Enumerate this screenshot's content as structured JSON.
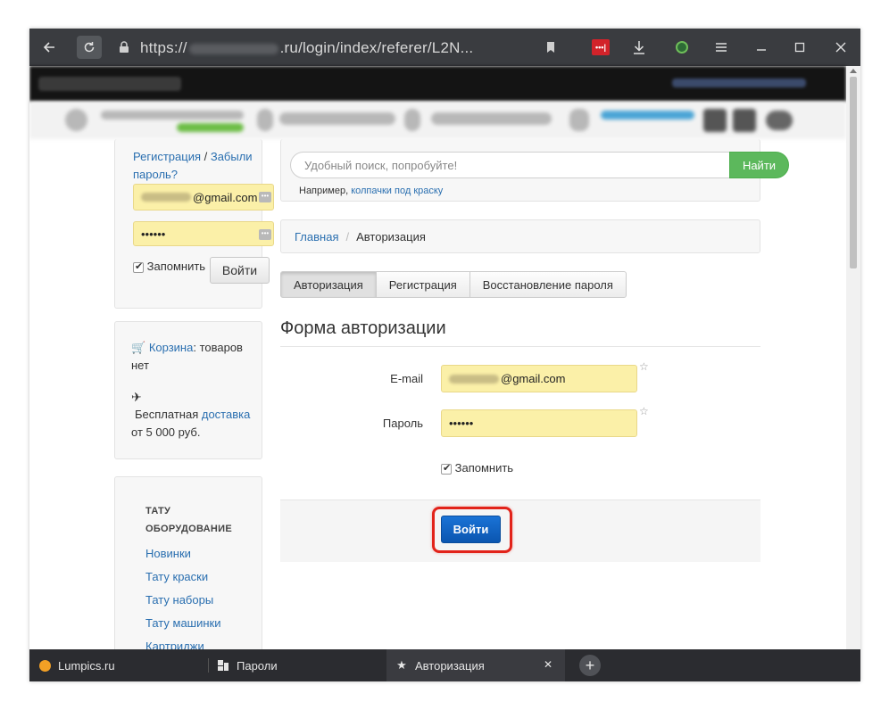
{
  "browser": {
    "url_prefix": "https://",
    "url_suffix": ".ru/login/index/referer/L2N...",
    "lastpass_label": "•••|"
  },
  "sidebar": {
    "register_link": "Регистрация",
    "slash": " / ",
    "forgot_link": "Забыли пароль?",
    "email_suffix": "@gmail.com",
    "password_mask": "••••••",
    "remember_label": "Запомнить",
    "login_button": "Войти",
    "cart_link": "Корзина",
    "cart_text": ": товаров нет",
    "shipping_prefix": "Бесплатная ",
    "shipping_link": "доставка",
    "shipping_suffix": "от 5 000 руб.",
    "catalog_title": "ТАТУ ОБОРУДОВАНИЕ",
    "catalog_items": [
      "Новинки",
      "Тату краски",
      "Тату наборы",
      "Тату машинки",
      "Картриджи"
    ]
  },
  "search": {
    "placeholder": "Удобный поиск, попробуйте!",
    "button": "Найти",
    "hint_prefix": "Например, ",
    "hint_link": "колпачки под краску"
  },
  "breadcrumb": {
    "home": "Главная",
    "separator": "/",
    "current": "Авторизация"
  },
  "tabs": [
    "Авторизация",
    "Регистрация",
    "Восстановление пароля"
  ],
  "form": {
    "title": "Форма авторизации",
    "email_label": "E-mail",
    "email_suffix": "@gmail.com",
    "password_label": "Пароль",
    "password_mask": "••••••",
    "star": "☆",
    "remember_label": "Запомнить",
    "submit": "Войти"
  },
  "tabbar": {
    "tabs": [
      {
        "label": "Lumpics.ru"
      },
      {
        "label": "Пароли"
      },
      {
        "label": "Авторизация"
      }
    ],
    "close_glyph": "✕",
    "new_tab_glyph": "+"
  },
  "colors": {
    "accent_link": "#2a6fb0",
    "search_button": "#5cb85c",
    "primary_button": "#0b56b0",
    "highlight": "#e2231a",
    "autofill": "#fbf0a8"
  }
}
